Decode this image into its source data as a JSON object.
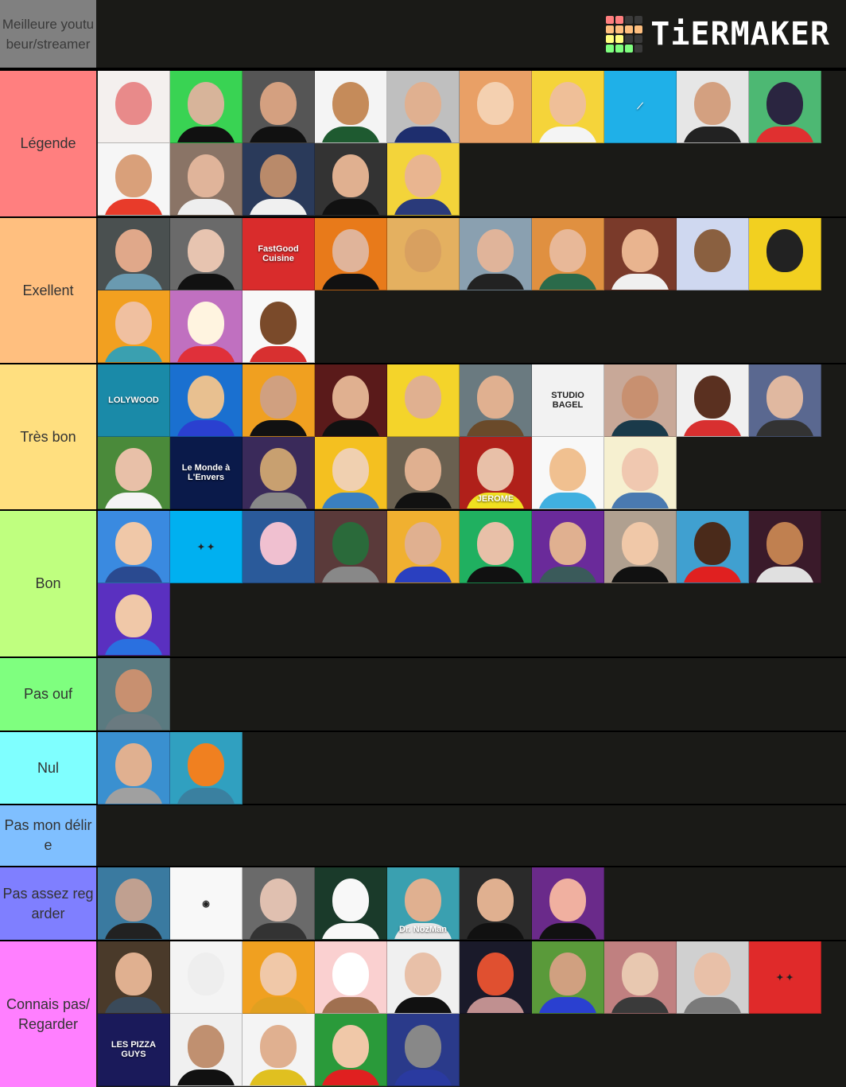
{
  "header": {
    "title": "Meilleure youtubeur/streamer",
    "logo_text": "TiERMAKER",
    "logo_grid_colors": [
      "#ff7f7f",
      "#ff7f7f",
      "#3a3a3a",
      "#3a3a3a",
      "#ffbf7f",
      "#ffbf7f",
      "#ffbf7f",
      "#ffbf7f",
      "#ffff7f",
      "#ffff7f",
      "#3a3a3a",
      "#3a3a3a",
      "#7fff7f",
      "#7fff7f",
      "#7fff7f",
      "#3a3a3a"
    ]
  },
  "tiers": [
    {
      "label": "Légende",
      "color": "#ff7f7f",
      "items": [
        {
          "name": "glowing-eyes-face",
          "bg": "#f4f0ee",
          "skin": "#e88a8a",
          "shirt": "#f4f0ee"
        },
        {
          "name": "tattooed-hood-face",
          "bg": "#39d353",
          "skin": "#d7b49a",
          "shirt": "#111"
        },
        {
          "name": "smiling-man-dark",
          "bg": "#555",
          "skin": "#d4a080",
          "shirt": "#111"
        },
        {
          "name": "green-cap-man",
          "bg": "#f4f4f4",
          "skin": "#c58b5a",
          "shirt": "#1e5a30"
        },
        {
          "name": "grey-cap-man",
          "bg": "#bfbfbf",
          "skin": "#e0b090",
          "shirt": "#1e2e6e"
        },
        {
          "name": "mustache-cartoon",
          "bg": "#e9a066",
          "skin": "#f4d0b0",
          "shirt": "#e9a066"
        },
        {
          "name": "glasses-man-yellow",
          "bg": "#f5d43a",
          "skin": "#efbf98",
          "shirt": "#f4f4f4"
        },
        {
          "name": "blue-logo",
          "bg": "#1fb0e8",
          "text": "⟋"
        },
        {
          "name": "bearded-glasses-man",
          "bg": "#e6e6e6",
          "skin": "#d3a080",
          "shirt": "#222"
        },
        {
          "name": "cat-cartoon",
          "bg": "#4db873",
          "skin": "#2a2540",
          "shirt": "#e03030"
        },
        {
          "name": "duo-red-shirt",
          "bg": "#f6f6f6",
          "skin": "#d9a07a",
          "shirt": "#e83b2a"
        },
        {
          "name": "man-with-baby-heart",
          "bg": "#8a7466",
          "skin": "#e0b49a",
          "shirt": "#eee"
        },
        {
          "name": "man-white-tee-blue",
          "bg": "#2a3a5a",
          "skin": "#b98a6a",
          "shirt": "#f0f0f0"
        },
        {
          "name": "mario-cap-man",
          "bg": "#333",
          "skin": "#e0b090",
          "shirt": "#111"
        },
        {
          "name": "laughing-striped-shirt",
          "bg": "#f3d43a",
          "skin": "#e9b590",
          "shirt": "#2a3a7a"
        }
      ]
    },
    {
      "label": "Exellent",
      "color": "#ffbf7f",
      "items": [
        {
          "name": "cap-bearded-man",
          "bg": "#4a5050",
          "skin": "#e0a88a",
          "shirt": "#6a9ab0"
        },
        {
          "name": "sunglasses-teen",
          "bg": "#6a6a6a",
          "skin": "#e7c4b0",
          "shirt": "#111"
        },
        {
          "name": "fastgood-cuisine-logo",
          "bg": "#d92c2c",
          "text": "FastGood Cuisine"
        },
        {
          "name": "mlg-cap-explosion",
          "bg": "#e87a1a",
          "skin": "#e0b49a",
          "shirt": "#111"
        },
        {
          "name": "sunglasses-closeup",
          "bg": "#e4b060",
          "skin": "#d8a060",
          "shirt": "#e4b060"
        },
        {
          "name": "windy-man",
          "bg": "#8aa0b0",
          "skin": "#e0b49a",
          "shirt": "#222"
        },
        {
          "name": "profile-haircut",
          "bg": "#e09040",
          "skin": "#e8b898",
          "shirt": "#2a6a4a"
        },
        {
          "name": "les-tutos",
          "bg": "#7a3a2a",
          "skin": "#e9b48f",
          "shirt": "#f0f0f0"
        },
        {
          "name": "potato-cartoon",
          "bg": "#cfd8f0",
          "skin": "#8a6040",
          "shirt": "#cfd8f0"
        },
        {
          "name": "yellow-circle-face",
          "bg": "#f2d020",
          "skin": "#222",
          "shirt": "#f2d020"
        },
        {
          "name": "blonde-cartoon-boy",
          "bg": "#f2a020",
          "skin": "#f0c0a0",
          "shirt": "#3aa0b0"
        },
        {
          "name": "red-pony",
          "bg": "#c070c0",
          "skin": "#fff4e0",
          "shirt": "#e0303a"
        },
        {
          "name": "straw-hat-cartoon",
          "bg": "#f8f8f8",
          "skin": "#7a4a2a",
          "shirt": "#d83030"
        }
      ]
    },
    {
      "label": "Très bon",
      "color": "#ffdf7f",
      "items": [
        {
          "name": "lolywood-logo",
          "bg": "#1a8aa8",
          "text": "LOLYWOOD"
        },
        {
          "name": "pixel-king",
          "bg": "#1a70d0",
          "skin": "#e8c090",
          "shirt": "#2a40d0"
        },
        {
          "name": "bearded-cartoon-orange",
          "bg": "#f0a020",
          "skin": "#d0a080",
          "shirt": "#111"
        },
        {
          "name": "microphone-man",
          "bg": "#5a1a1a",
          "skin": "#e0b090",
          "shirt": "#111"
        },
        {
          "name": "split-face-yellow",
          "bg": "#f4d42a",
          "skin": "#e0b090",
          "shirt": "#f4d42a"
        },
        {
          "name": "screaming-cap-man",
          "bg": "#6a7a80",
          "skin": "#e0b090",
          "shirt": "#6a4a2a"
        },
        {
          "name": "studio-bagel-logo",
          "bg": "#f2f2f2",
          "text": "STUDIO BAGEL",
          "dark": true
        },
        {
          "name": "smiling-asian-man",
          "bg": "#c8a898",
          "skin": "#c89070",
          "shirt": "#1a3a4a"
        },
        {
          "name": "clapperboard-duo",
          "bg": "#f0f0f0",
          "skin": "#5a3020",
          "shirt": "#d83030"
        },
        {
          "name": "dark-hair-man-blue",
          "bg": "#5a6890",
          "skin": "#e0b8a0",
          "shirt": "#333"
        },
        {
          "name": "curly-man-grass",
          "bg": "#4a8a3a",
          "skin": "#e8c0a8",
          "shirt": "#f4f4f4"
        },
        {
          "name": "le-monde-a-lenvers",
          "bg": "#0a1a4a",
          "text": "Le Monde à L'Envers"
        },
        {
          "name": "minecraft-knight",
          "bg": "#3a2a5a",
          "skin": "#c8a070",
          "shirt": "#888"
        },
        {
          "name": "grinning-cartoon",
          "bg": "#f4c020",
          "skin": "#f0d0b0",
          "shirt": "#3a80c0"
        },
        {
          "name": "smirking-man",
          "bg": "#6a6050",
          "skin": "#e0b090",
          "shirt": "#111"
        },
        {
          "name": "jerome",
          "bg": "#b0201a",
          "skin": "#e8c0a8",
          "shirt": "#f0e020",
          "text": "JEROME"
        },
        {
          "name": "cartoon-desk",
          "bg": "#f8f8f8",
          "skin": "#f0c090",
          "shirt": "#40b0e0"
        },
        {
          "name": "woman-denim-shirt",
          "bg": "#f6f0d0",
          "skin": "#f0c8b0",
          "shirt": "#4a7ab0"
        }
      ]
    },
    {
      "label": "Bon",
      "color": "#bfff7f",
      "items": [
        {
          "name": "cartoon-goatee",
          "bg": "#3a8ae0",
          "skin": "#f0c8a8",
          "shirt": "#2a4a90"
        },
        {
          "name": "blue-blob-face",
          "bg": "#00b0f0",
          "text": "✦ ✦",
          "dark": true
        },
        {
          "name": "angry-cartoon-boy",
          "bg": "#2a5a9a",
          "skin": "#f0c0d0",
          "shirt": "#2a5a9a"
        },
        {
          "name": "minecraft-swords",
          "bg": "#5a3a3a",
          "skin": "#2a6a3a",
          "shirt": "#888"
        },
        {
          "name": "excited-man-yellow",
          "bg": "#f0b030",
          "skin": "#e0b090",
          "shirt": "#2a40c0"
        },
        {
          "name": "sunglasses-green",
          "bg": "#20b060",
          "skin": "#e8c0a8",
          "shirt": "#111"
        },
        {
          "name": "retrowave-man",
          "bg": "#6a2a9a",
          "skin": "#e0b090",
          "shirt": "#3a5a5a"
        },
        {
          "name": "excited-blond-man",
          "bg": "#b0a090",
          "skin": "#f0c8a8",
          "shirt": "#111"
        },
        {
          "name": "red-bucket-hat",
          "bg": "#40a0d0",
          "skin": "#4a2a1a",
          "shirt": "#e02020"
        },
        {
          "name": "minecraft-fire",
          "bg": "#3a1a2a",
          "skin": "#c08050",
          "shirt": "#e0e0e0"
        },
        {
          "name": "fire-cartoon-logo",
          "bg": "#5a30c0",
          "skin": "#f0c8a8",
          "shirt": "#2a70e0"
        }
      ]
    },
    {
      "label": "Pas ouf",
      "color": "#7fff7f",
      "items": [
        {
          "name": "muscular-man",
          "bg": "#5a7a80",
          "skin": "#c89070",
          "shirt": "#6a7a80"
        }
      ]
    },
    {
      "label": "Nul",
      "color": "#7fffff",
      "items": [
        {
          "name": "grey-hoodie-man",
          "bg": "#3a90d0",
          "skin": "#e0b090",
          "shirt": "#a0a0a0"
        },
        {
          "name": "fortnite-fish",
          "bg": "#30a0c0",
          "skin": "#f08020",
          "shirt": "#3a80a0"
        }
      ]
    },
    {
      "label": "Pas mon délire",
      "color": "#7fbfff",
      "items": []
    },
    {
      "label": "Pas assez regarder",
      "color": "#7f7fff",
      "items": [
        {
          "name": "beanie-bearded-man",
          "bg": "#3a7aa0",
          "skin": "#c0a090",
          "shirt": "#222"
        },
        {
          "name": "red-swirl-logo",
          "bg": "#f8f8f8",
          "text": "◉",
          "dark": true
        },
        {
          "name": "headset-man",
          "bg": "#6a6a6a",
          "skin": "#e0c0b0",
          "shirt": "#333"
        },
        {
          "name": "white-blob-network",
          "bg": "#1a3a2a",
          "skin": "#f8f8f8",
          "shirt": "#f8f8f8"
        },
        {
          "name": "dr-nozman",
          "bg": "#3aa0b0",
          "skin": "#e0b090",
          "shirt": "#e8e8e8",
          "text": "Dr. NozMan"
        },
        {
          "name": "hoodie-man-stage",
          "bg": "#2a2a2a",
          "skin": "#e0b090",
          "shirt": "#111"
        },
        {
          "name": "masked-memoji",
          "bg": "#6a2a8a",
          "skin": "#f0b0a0",
          "shirt": "#111"
        }
      ]
    },
    {
      "label": "Connais pas/Regarder",
      "color": "#ff7fff",
      "items": [
        {
          "name": "curly-hair-glasses",
          "bg": "#4a3a2a",
          "skin": "#e0b090",
          "shirt": "#3a4a5a"
        },
        {
          "name": "watermelon-dog",
          "bg": "#f4f4f4",
          "skin": "#eeeeee",
          "shirt": "#f4f4f4"
        },
        {
          "name": "thinking-man-yellow",
          "bg": "#f0a020",
          "skin": "#f0c8a8",
          "shirt": "#e0a020"
        },
        {
          "name": "cartoon-girl",
          "bg": "#fad0d0",
          "skin": "#fff",
          "shirt": "#a07050"
        },
        {
          "name": "curly-woman",
          "bg": "#f0f0f0",
          "skin": "#e8c0a8",
          "shirt": "#111"
        },
        {
          "name": "bird-hat-cartoon",
          "bg": "#1a1a2a",
          "skin": "#e05030",
          "shirt": "#c09090"
        },
        {
          "name": "woman-blue-top",
          "bg": "#5a9a3a",
          "skin": "#d0a080",
          "shirt": "#2a40d0"
        },
        {
          "name": "blonde-woman",
          "bg": "#c08080",
          "skin": "#e8c8b0",
          "shirt": "#3a3a3a"
        },
        {
          "name": "brunette-woman",
          "bg": "#d0d0d0",
          "skin": "#e8c0a8",
          "shirt": "#7a7a7a"
        },
        {
          "name": "red-blob-face",
          "bg": "#e02a2a",
          "text": "✦ ✦",
          "dark": true
        },
        {
          "name": "les-pizza-guys",
          "bg": "#1a1a5a",
          "text": "LES PIZZA GUYS"
        },
        {
          "name": "curly-woman-black",
          "bg": "#f0f0f0",
          "skin": "#c09070",
          "shirt": "#111"
        },
        {
          "name": "surprised-bearded-man",
          "bg": "#f4f4f4",
          "skin": "#e0b090",
          "shirt": "#e0c020"
        },
        {
          "name": "blonde-girl-green",
          "bg": "#2a9a3a",
          "skin": "#f0c8a8",
          "shirt": "#e02020"
        },
        {
          "name": "minecraft-blue-skin",
          "bg": "#2a3a8a",
          "skin": "#888",
          "shirt": "#2a3aa0"
        }
      ]
    }
  ]
}
